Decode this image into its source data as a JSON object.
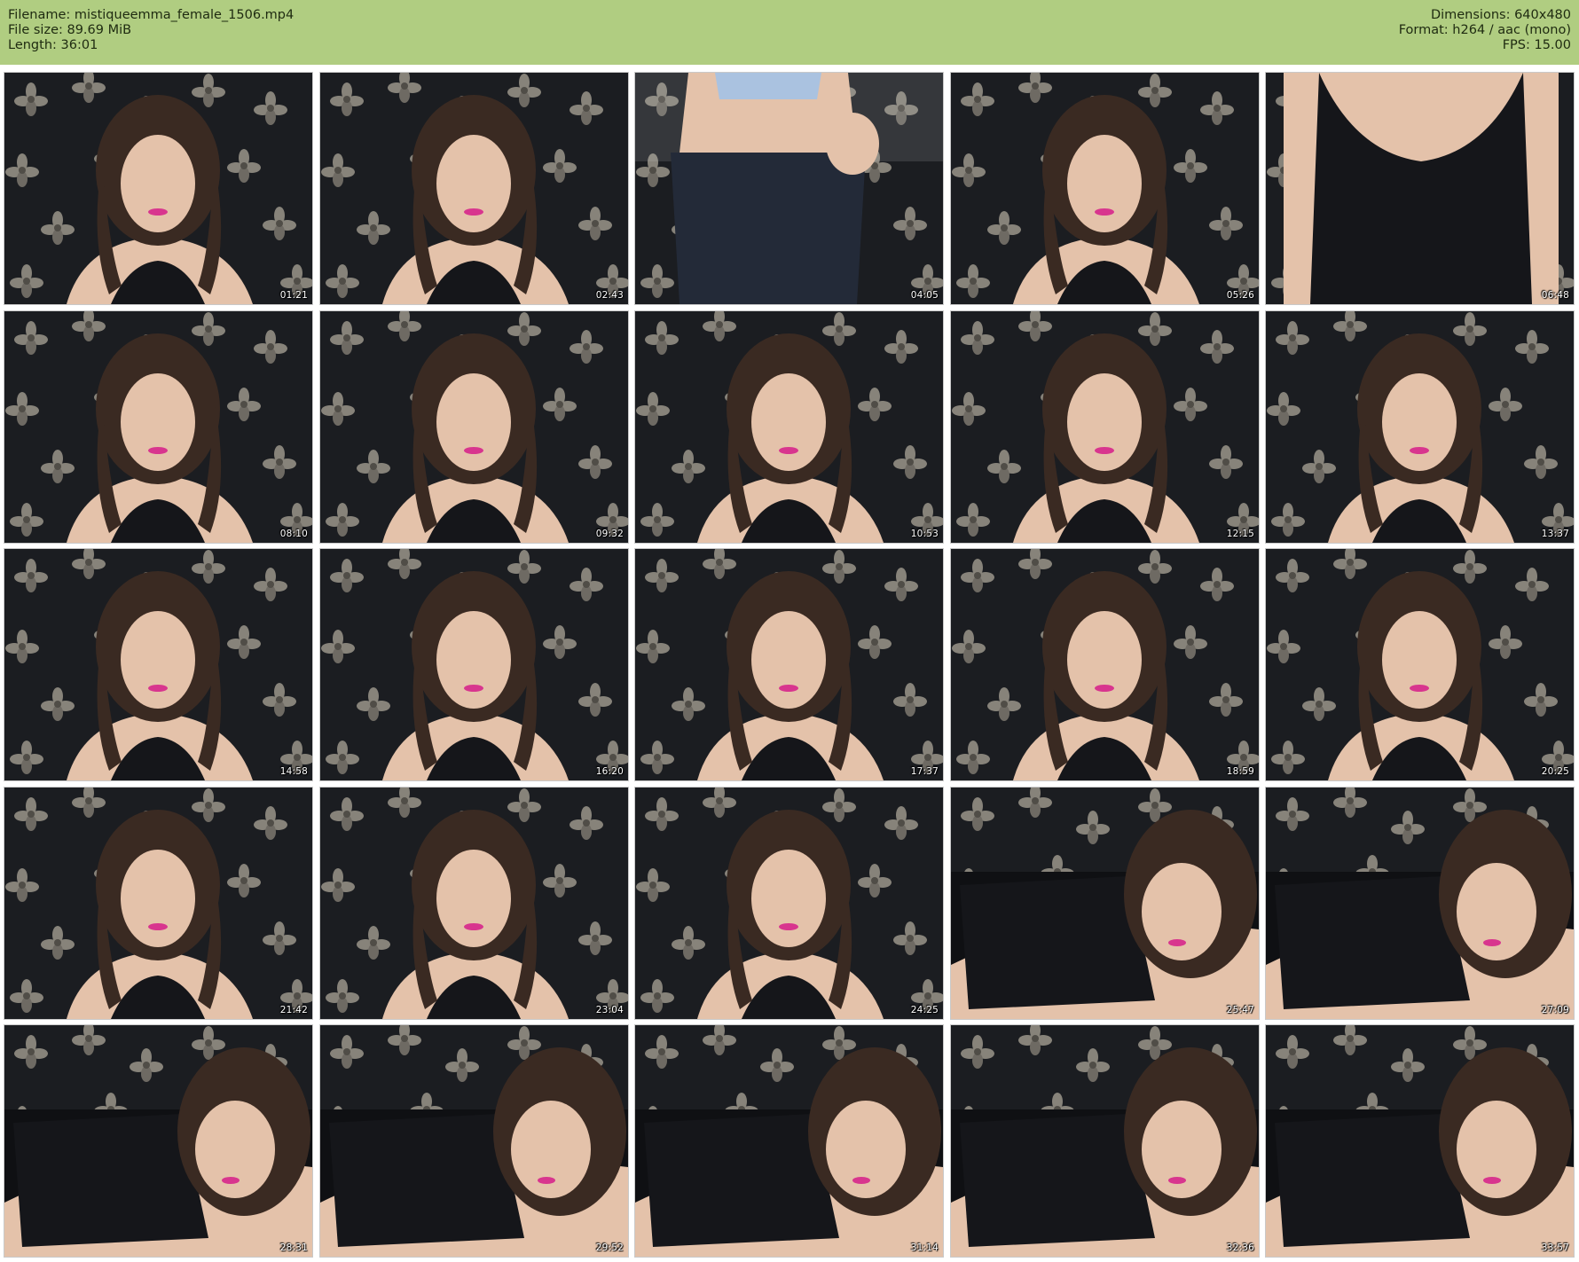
{
  "header": {
    "filename_label": "Filename:",
    "filename": "mistiqueemma_female_1506.mp4",
    "filesize_label": "File size:",
    "filesize": "89.69 MiB",
    "length_label": "Length:",
    "length": "36:01",
    "dimensions_label": "Dimensions:",
    "dimensions": "640x480",
    "format_label": "Format:",
    "format": "h264 / aac (mono)",
    "fps_label": "FPS:",
    "fps": "15.00"
  },
  "thumbnails": [
    {
      "timestamp": "01:21",
      "scene": "face"
    },
    {
      "timestamp": "02:43",
      "scene": "face"
    },
    {
      "timestamp": "04:05",
      "scene": "torso"
    },
    {
      "timestamp": "05:26",
      "scene": "face"
    },
    {
      "timestamp": "06:48",
      "scene": "torso-dark"
    },
    {
      "timestamp": "08:10",
      "scene": "face"
    },
    {
      "timestamp": "09:32",
      "scene": "face"
    },
    {
      "timestamp": "10:53",
      "scene": "face"
    },
    {
      "timestamp": "12:15",
      "scene": "face"
    },
    {
      "timestamp": "13:37",
      "scene": "face"
    },
    {
      "timestamp": "14:58",
      "scene": "face"
    },
    {
      "timestamp": "16:20",
      "scene": "face"
    },
    {
      "timestamp": "17:37",
      "scene": "face"
    },
    {
      "timestamp": "18:59",
      "scene": "face"
    },
    {
      "timestamp": "20:25",
      "scene": "face"
    },
    {
      "timestamp": "21:42",
      "scene": "face"
    },
    {
      "timestamp": "23:04",
      "scene": "face"
    },
    {
      "timestamp": "24:25",
      "scene": "face"
    },
    {
      "timestamp": "25:47",
      "scene": "lying"
    },
    {
      "timestamp": "27:09",
      "scene": "lying"
    },
    {
      "timestamp": "28:31",
      "scene": "lying"
    },
    {
      "timestamp": "29:52",
      "scene": "lying"
    },
    {
      "timestamp": "31:14",
      "scene": "lying"
    },
    {
      "timestamp": "32:36",
      "scene": "lying"
    },
    {
      "timestamp": "33:57",
      "scene": "lying"
    }
  ],
  "colors": {
    "header_bg": "#b0cd81",
    "wallpaper": "#1b1d21",
    "flower": "#9a958a",
    "skin": "#e4c2aa",
    "hair": "#3a2a22",
    "top": "#15161a"
  }
}
